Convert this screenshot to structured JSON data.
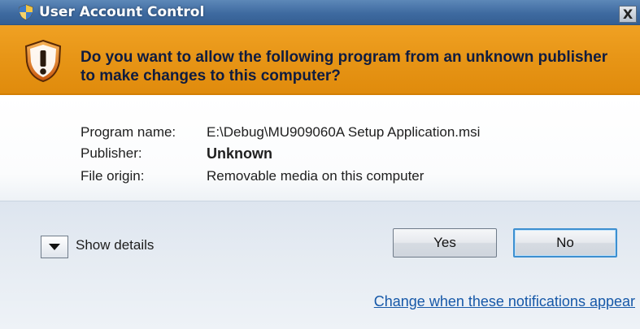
{
  "window": {
    "title": "User Account Control",
    "close_label": "X"
  },
  "banner": {
    "question": "Do you want to allow the following program from an unknown publisher to make changes to this computer?"
  },
  "details": {
    "program_name_label": "Program name:",
    "program_name_value": "E:\\Debug\\MU909060A Setup Application.msi",
    "publisher_label": "Publisher:",
    "publisher_value": "Unknown",
    "file_origin_label": "File origin:",
    "file_origin_value": "Removable media on this computer"
  },
  "footer": {
    "show_details_label": "Show details",
    "yes_label": "Yes",
    "no_label": "No",
    "change_notifications_link": "Change when these notifications appear"
  },
  "icons": {
    "title_icon": "uac-shield-icon",
    "banner_icon": "warning-shield-icon",
    "toggle_icon": "chevron-down-icon"
  },
  "colors": {
    "banner_orange": "#e8941a",
    "title_blue": "#3e6aa0",
    "link_blue": "#1658a8",
    "focus_blue": "#3d8fd0"
  }
}
